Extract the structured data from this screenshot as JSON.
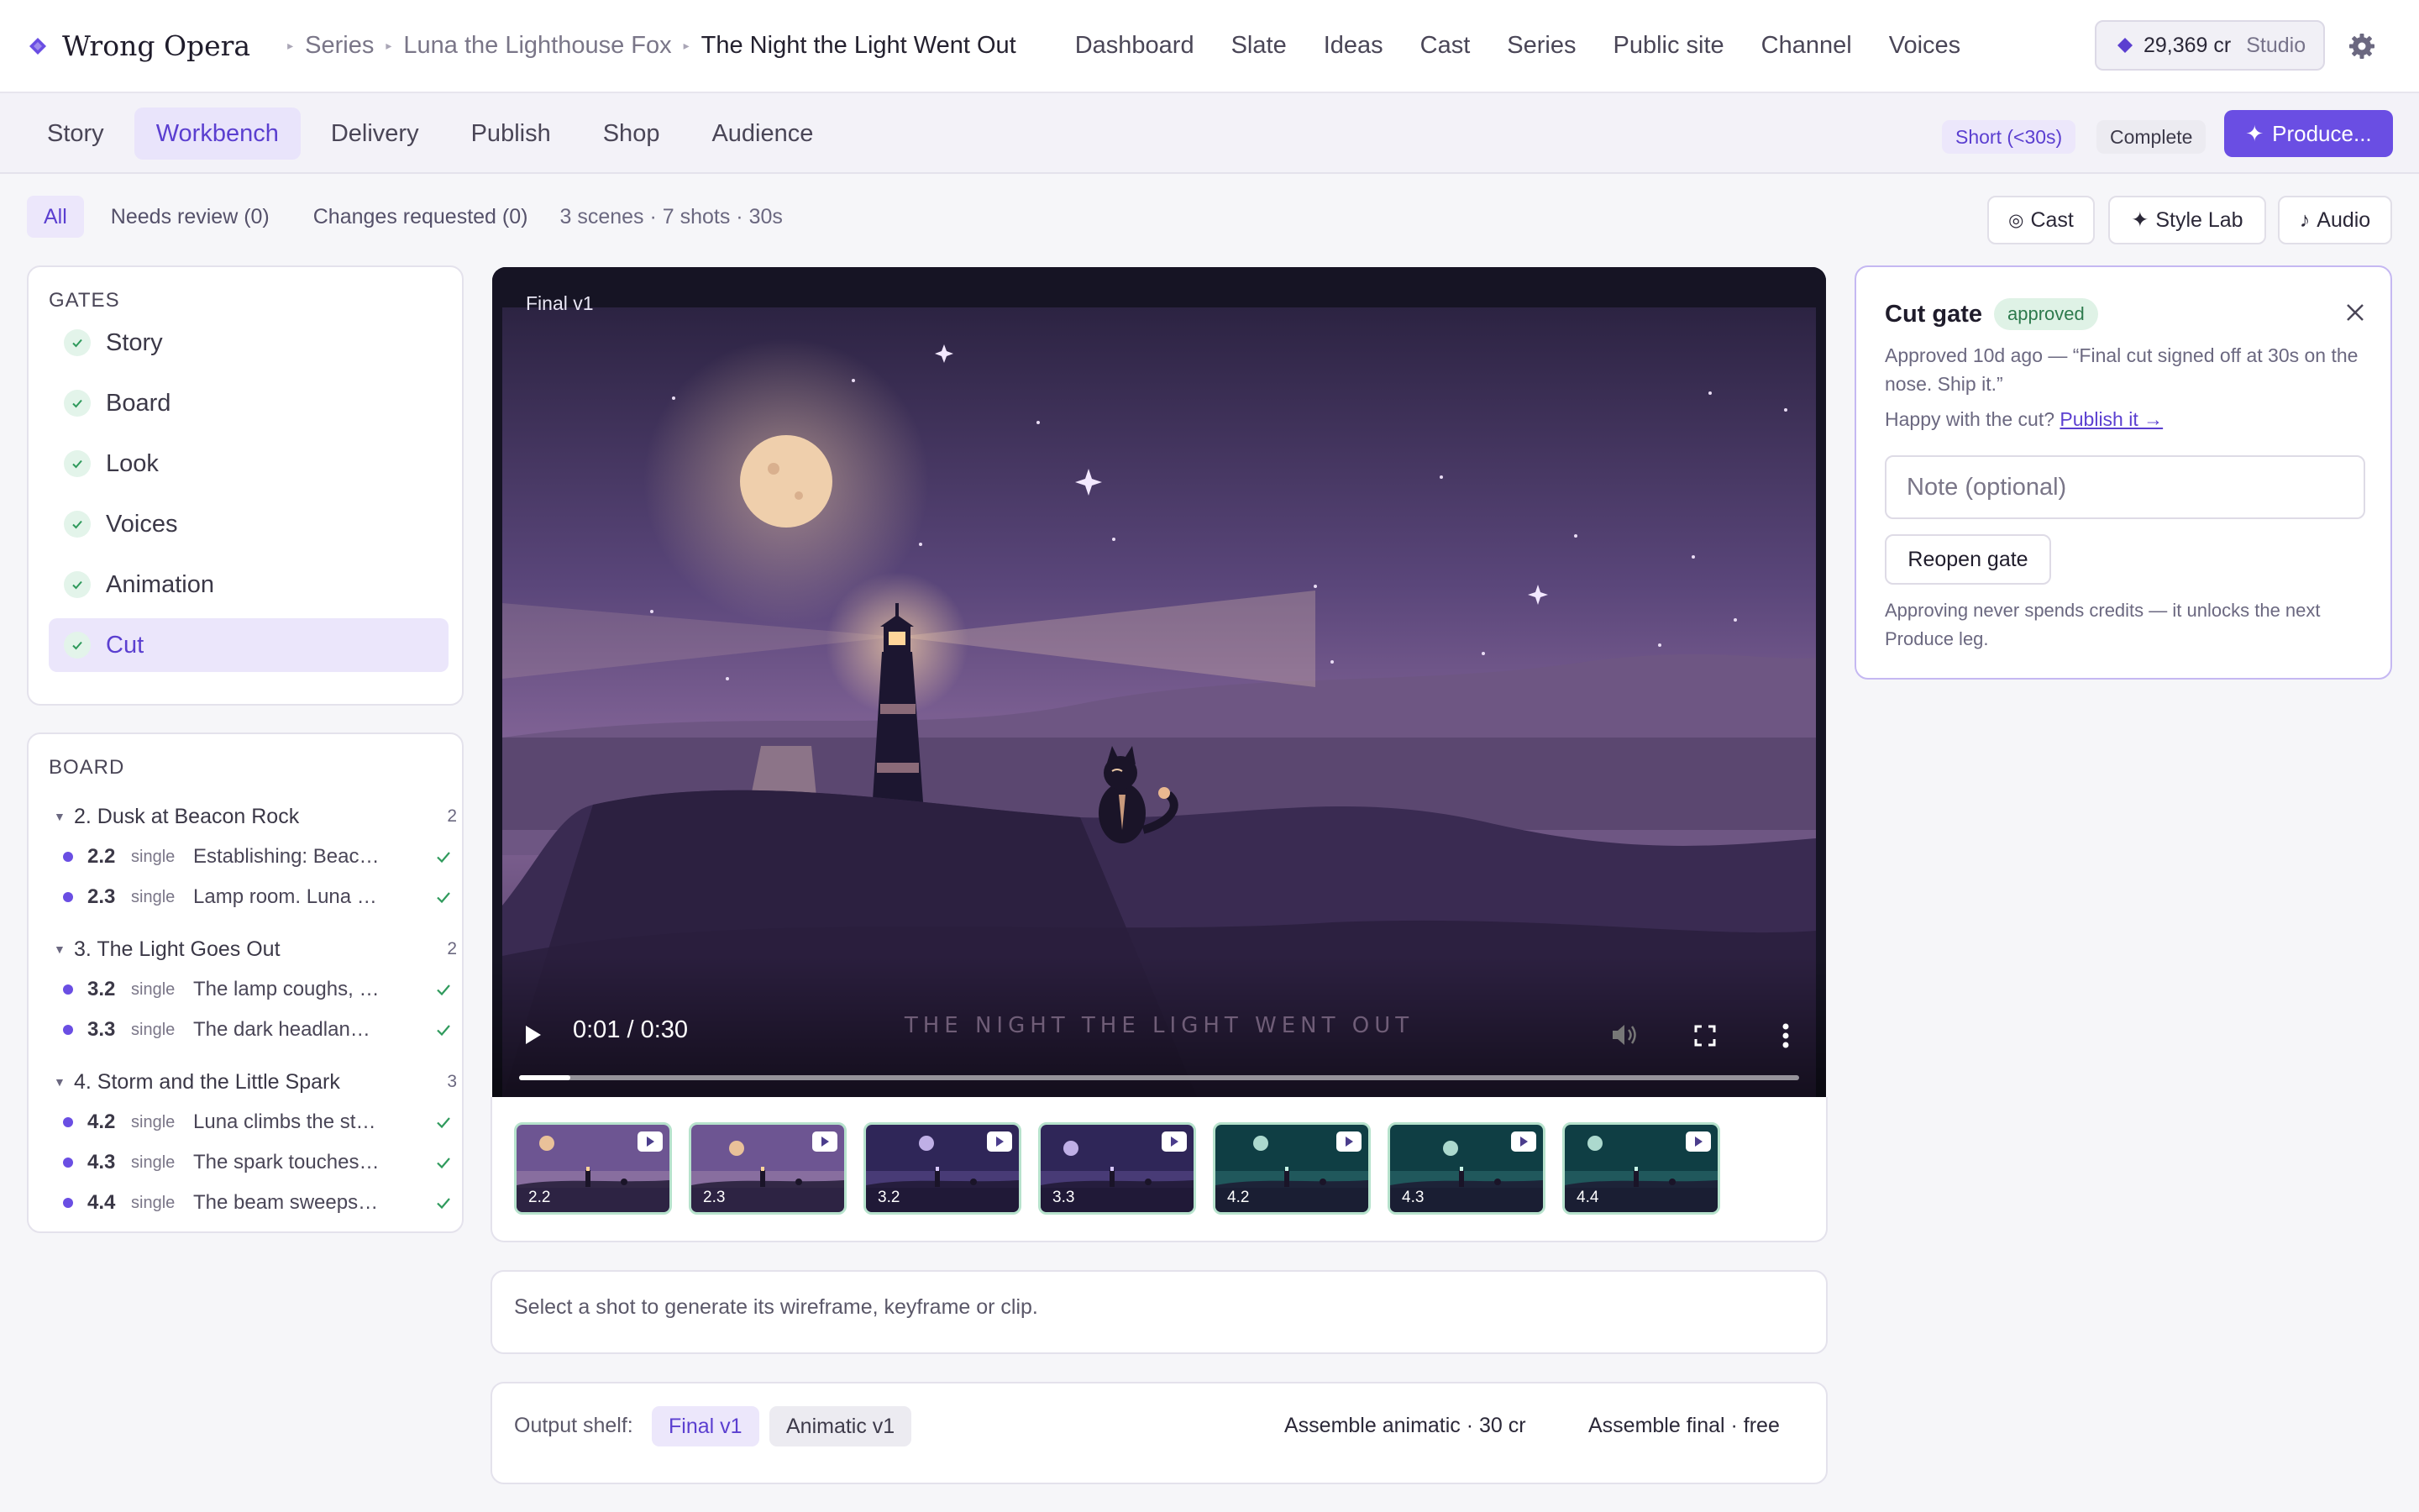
{
  "app": {
    "name": "Wrong Opera"
  },
  "breadcrumb": [
    "Series",
    "Luna the Lighthouse Fox",
    "The Night the Light Went Out"
  ],
  "topnav": [
    "Dashboard",
    "Slate",
    "Ideas",
    "Cast",
    "Series",
    "Public site",
    "Channel",
    "Voices"
  ],
  "credits": {
    "amount": "29,369 cr",
    "plan": "Studio"
  },
  "tabs": [
    "Story",
    "Workbench",
    "Delivery",
    "Publish",
    "Shop",
    "Audience"
  ],
  "active_tab": "Workbench",
  "tags": {
    "length": "Short (<30s)",
    "status": "Complete"
  },
  "produce_label": "Produce...",
  "filters": {
    "all": "All",
    "needs_review": "Needs review (0)",
    "changes_requested": "Changes requested (0)",
    "summary": "3 scenes · 7 shots · 30s"
  },
  "tools": {
    "cast": "Cast",
    "style_lab": "Style Lab",
    "audio": "Audio"
  },
  "gates": {
    "title": "GATES",
    "items": [
      "Story",
      "Board",
      "Look",
      "Voices",
      "Animation",
      "Cut"
    ],
    "active": "Cut"
  },
  "board": {
    "title": "BOARD",
    "scenes": [
      {
        "title": "2. Dusk at Beacon Rock",
        "count": "2",
        "shots": [
          {
            "num": "2.2",
            "kind": "single",
            "desc": "Establishing: Beacon Rock at dusk"
          },
          {
            "num": "2.3",
            "kind": "single",
            "desc": "Lamp room. Luna checks the lamp"
          }
        ]
      },
      {
        "title": "3. The Light Goes Out",
        "count": "2",
        "shots": [
          {
            "num": "3.2",
            "kind": "single",
            "desc": "The lamp coughs, flickers"
          },
          {
            "num": "3.3",
            "kind": "single",
            "desc": "The dark headland at night"
          }
        ]
      },
      {
        "title": "4. Storm and the Little Spark",
        "count": "3",
        "shots": [
          {
            "num": "4.2",
            "kind": "single",
            "desc": "Luna climbs the stairs"
          },
          {
            "num": "4.3",
            "kind": "single",
            "desc": "The spark touches the lamp"
          },
          {
            "num": "4.4",
            "kind": "single",
            "desc": "The beam sweeps the sea"
          }
        ]
      }
    ]
  },
  "player": {
    "label": "Final v1",
    "time": "0:01 / 0:30",
    "progress": 0.04,
    "caption": "THE NIGHT THE LIGHT WENT OUT"
  },
  "thumbnails": [
    {
      "label": "2.2",
      "palette": "dusk"
    },
    {
      "label": "2.3",
      "palette": "dusk"
    },
    {
      "label": "3.2",
      "palette": "night"
    },
    {
      "label": "3.3",
      "palette": "night"
    },
    {
      "label": "4.2",
      "palette": "teal"
    },
    {
      "label": "4.3",
      "palette": "teal"
    },
    {
      "label": "4.4",
      "palette": "teal"
    }
  ],
  "generate_message": "Select a shot to generate its wireframe, keyframe or clip.",
  "output_shelf": {
    "label": "Output shelf:",
    "items": [
      "Final v1",
      "Animatic v1"
    ],
    "actions": [
      "Assemble animatic · 30 cr",
      "Assemble final · free"
    ]
  },
  "cut_gate": {
    "title": "Cut gate",
    "status": "approved",
    "text": "Approved 10d ago — “Final cut signed off at 30s on the nose. Ship it.”",
    "happy": "Happy with the cut?",
    "publish_link": "Publish it →",
    "note_placeholder": "Note (optional)",
    "reopen": "Reopen gate",
    "footer": "Approving never spends credits — it unlocks the next Produce leg."
  },
  "colors": {
    "accent": "#6a4ee3",
    "approved": "#2d7a4d",
    "check": "#2f9a5c"
  }
}
